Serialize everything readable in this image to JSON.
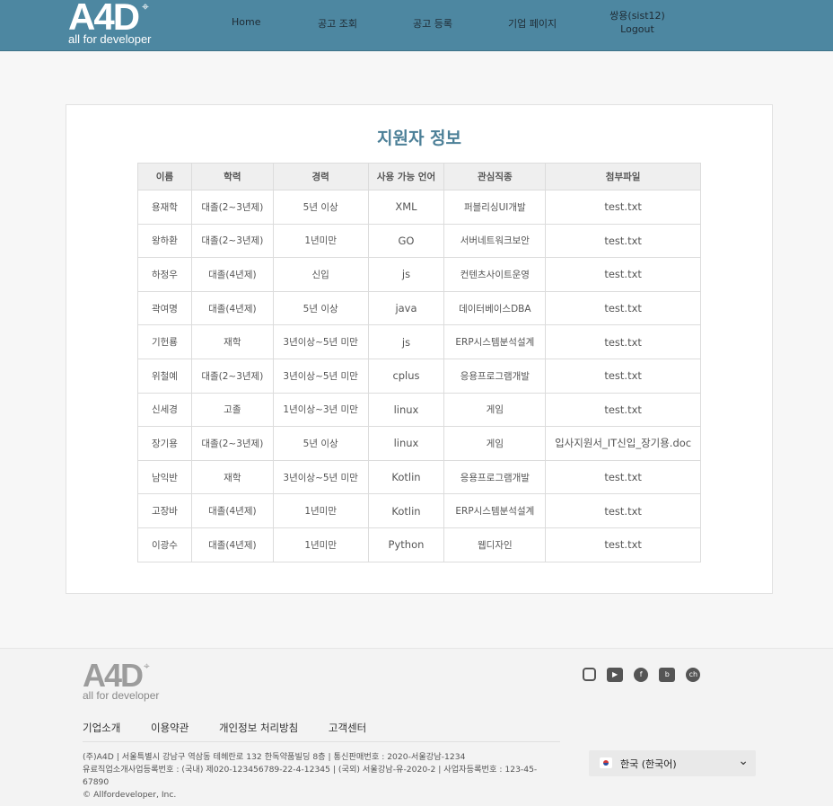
{
  "brand": {
    "mark": "A4D",
    "tagline": "all for developer"
  },
  "nav": {
    "items": [
      "Home",
      "공고 조회",
      "공고 등록",
      "기업 페이지"
    ],
    "user": "쌍용(sist12)",
    "logout": "Logout"
  },
  "page": {
    "title": "지원자 정보"
  },
  "table": {
    "headers": [
      "이름",
      "학력",
      "경력",
      "사용 가능 언어",
      "관심직종",
      "첨부파일"
    ],
    "rows": [
      [
        "용재학",
        "대졸(2~3년제)",
        "5년 이상",
        "XML",
        "퍼블리싱UI개발",
        "test.txt"
      ],
      [
        "왕하환",
        "대졸(2~3년제)",
        "1년미만",
        "GO",
        "서버네트워크보안",
        "test.txt"
      ],
      [
        "하정우",
        "대졸(4년제)",
        "신입",
        "js",
        "컨텐츠사이트운영",
        "test.txt"
      ],
      [
        "곽여명",
        "대졸(4년제)",
        "5년 이상",
        "java",
        "데이터베이스DBA",
        "test.txt"
      ],
      [
        "기헌룡",
        "재학",
        "3년이상~5년 미만",
        "js",
        "ERP시스템분석설계",
        "test.txt"
      ],
      [
        "위철예",
        "대졸(2~3년제)",
        "3년이상~5년 미만",
        "cplus",
        "응용프로그램개발",
        "test.txt"
      ],
      [
        "신세경",
        "고졸",
        "1년이상~3년 미만",
        "linux",
        "게임",
        "test.txt"
      ],
      [
        "장기용",
        "대졸(2~3년제)",
        "5년 이상",
        "linux",
        "게임",
        "입사지원서_IT신입_장기용.doc"
      ],
      [
        "남익반",
        "재학",
        "3년이상~5년 미만",
        "Kotlin",
        "응용프로그램개발",
        "test.txt"
      ],
      [
        "고장바",
        "대졸(4년제)",
        "1년미만",
        "Kotlin",
        "ERP시스템분석설계",
        "test.txt"
      ],
      [
        "이광수",
        "대졸(4년제)",
        "1년미만",
        "Python",
        "웹디자인",
        "test.txt"
      ]
    ]
  },
  "footer": {
    "links": [
      "기업소개",
      "이용약관",
      "개인정보 처리방침",
      "고객센터"
    ],
    "info": [
      "(주)A4D | 서울특별시 강남구 역삼동 테헤란로 132 한독약품빌딩 8층 | 통신판매번호 : 2020-서울강남-1234",
      "유료직업소개사업등록번호 : (국내) 제020-123456789-22-4-12345 | (국외) 서울강남-유-2020-2 | 사업자등록번호 : 123-45-67890",
      "© Allfordeveloper, Inc."
    ],
    "socials": [
      "instagram-icon",
      "youtube-icon",
      "facebook-icon",
      "blog-icon",
      "kakao-channel-icon"
    ],
    "language": "한국 (한국어)"
  }
}
